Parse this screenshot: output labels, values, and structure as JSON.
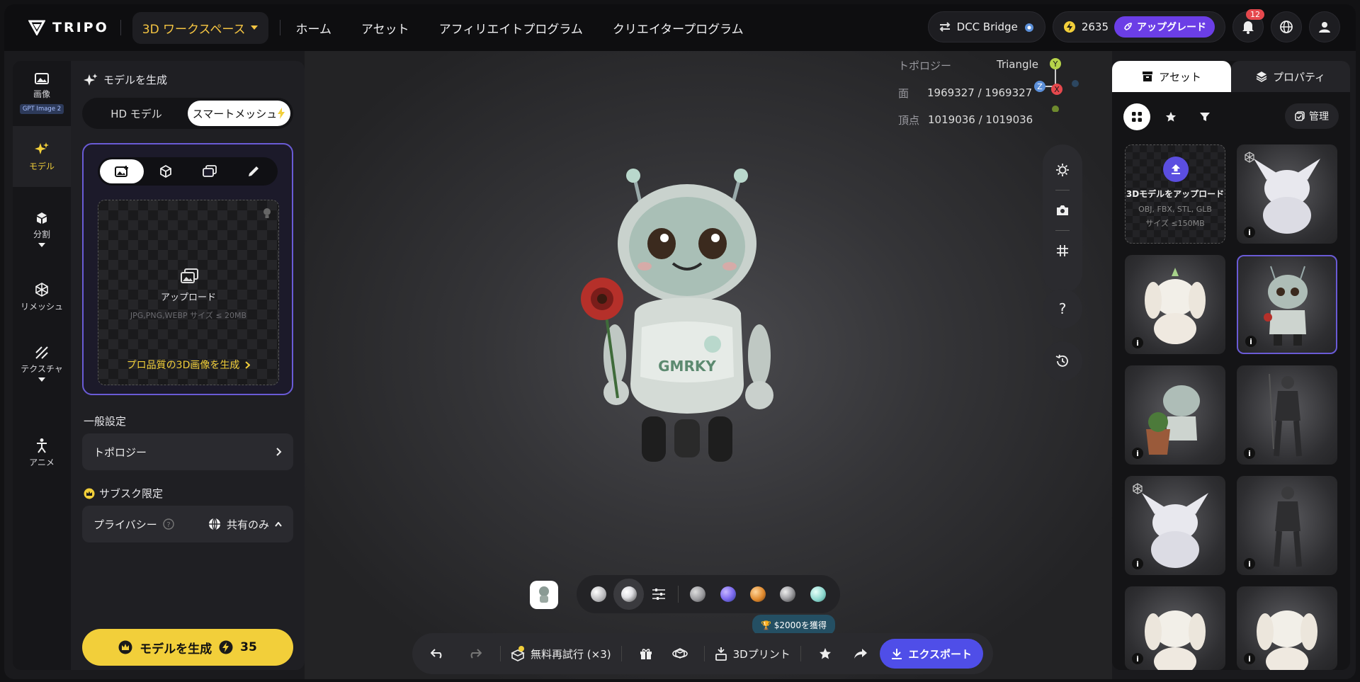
{
  "header": {
    "brand": "TRIPO",
    "workspace": "3D ワークスペース",
    "nav": [
      "ホーム",
      "アセット",
      "アフィリエイトプログラム",
      "クリエイタープログラム"
    ],
    "dcc": "DCC Bridge",
    "credits": "2635",
    "upgrade": "アップグレード",
    "notif_count": "12"
  },
  "rail": {
    "image": "画像",
    "gpt_badge": "GPT Image 2",
    "model": "モデル",
    "split": "分割",
    "remesh": "リメッシュ",
    "texture": "テクスチャ",
    "anime": "アニメ"
  },
  "panel": {
    "title": "モデルを生成",
    "hd": "HD モデル",
    "smart": "スマートメッシュ",
    "upload": "アップロード",
    "upload_hint": "JPG,PNG,WEBP サイズ ≤ 20MB",
    "pro_link": "プロ品質の3D画像を生成",
    "general": "一般設定",
    "topology": "トポロジー",
    "subs": "サブスク限定",
    "privacy": "プライバシー",
    "privacy_value": "共有のみ",
    "generate": "モデルを生成",
    "cost": "35"
  },
  "viewport": {
    "topo_label": "トポロジー",
    "topo_value": "Triangle",
    "faces_label": "面",
    "faces_value": "1969327 / 1969327",
    "verts_label": "頂点",
    "verts_value": "1019036 / 1019036",
    "axis_y": "Y",
    "axis_z": "Z",
    "axis_x": "X",
    "help": "?",
    "robot_text": "GMRKY"
  },
  "bottombar": {
    "retry": "無料再試行 (×3)",
    "print": "3Dプリント",
    "export": "エクスポート",
    "promo": "$2000を獲得"
  },
  "materials": [
    "#bdbdc0",
    "#e0e0e4",
    "#9a9a9e",
    "#7f6cf0",
    "#e08a2e",
    "#a6a6aa",
    "#8fd8cf"
  ],
  "right": {
    "tab_assets": "アセット",
    "tab_props": "プロパティ",
    "manage": "管理",
    "upload_title": "3Dモデルをアップロード",
    "upload_formats": "OBJ, FBX, STL, GLB",
    "upload_size": "サイズ ≤150MB",
    "info": "i"
  },
  "colors": {
    "accent": "#f2cf3a",
    "purple": "#6b3ee6",
    "blue": "#4f4ee8",
    "selection": "#6a5bd6"
  }
}
